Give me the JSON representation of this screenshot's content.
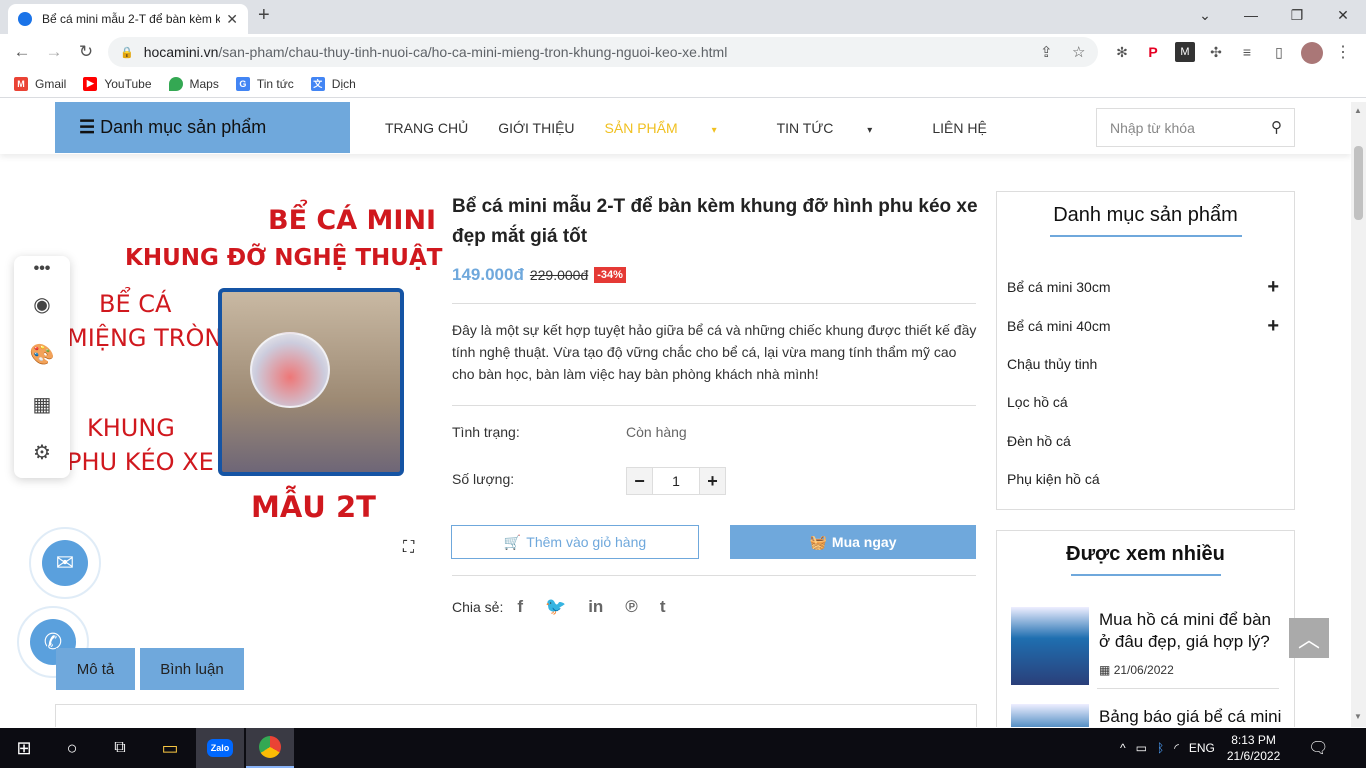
{
  "browser": {
    "tab_title": "Bể cá mini mẫu 2-T để bàn kèm k",
    "url_domain": "hocamini.vn",
    "url_path": "/san-pham/chau-thuy-tinh-nuoi-ca/ho-ca-mini-mieng-tron-khung-nguoi-keo-xe.html",
    "bookmarks": [
      {
        "label": "Gmail",
        "color": "#ea4335",
        "icon": "gmail-icon"
      },
      {
        "label": "YouTube",
        "color": "#ff0000",
        "icon": "youtube-icon"
      },
      {
        "label": "Maps",
        "color": "#34a853",
        "icon": "maps-icon"
      },
      {
        "label": "Tin tức",
        "color": "#4285f4",
        "icon": "news-icon"
      },
      {
        "label": "Dịch",
        "color": "#4285f4",
        "icon": "translate-icon"
      }
    ]
  },
  "site": {
    "category_button": "Danh mục sản phẩm",
    "menu": [
      "TRANG CHỦ",
      "GIỚI THIỆU",
      "SẢN PHẨM",
      "TIN TỨC",
      "LIÊN HỆ"
    ],
    "search_placeholder": "Nhập từ khóa",
    "accent": "#6fa8dc"
  },
  "product_image": {
    "line1": "BỂ CÁ MINI",
    "line2": "KHUNG ĐỠ NGHỆ THUẬT",
    "label1a": "BỂ CÁ",
    "label1b": "MIỆNG TRÒN",
    "label2a": "KHUNG",
    "label2b": "PHU KÉO XE",
    "model": "MẪU 2T"
  },
  "product": {
    "title": "Bể cá mini mẫu 2-T để bàn kèm khung đỡ hình phu kéo xe đẹp mắt giá tốt",
    "price_new": "149.000đ",
    "price_old": "229.000đ",
    "discount": "-34%",
    "description": "Đây là một sự kết hợp tuyệt hảo giữa bể cá và những chiếc khung được thiết kế đầy tính nghệ thuật. Vừa tạo độ vững chắc cho bể cá, lại vừa mang tính thẩm mỹ cao cho bàn học, bàn làm việc hay bàn phòng khách nhà mình!",
    "status_label": "Tình trạng:",
    "status_value": "Còn hàng",
    "qty_label": "Số lượng:",
    "qty_value": "1",
    "add_to_cart": "Thêm vào giỏ hàng",
    "buy_now": "Mua ngay",
    "share_label": "Chia sẻ:"
  },
  "tabs": [
    "Mô tả",
    "Bình luận"
  ],
  "sidebar": {
    "categories_title": "Danh mục sản phẩm",
    "categories": [
      "Bể cá mini 30cm",
      "Bể cá mini 40cm",
      "Chậu thủy tinh",
      "Lọc hồ cá",
      "Đèn hồ cá",
      "Phụ kiện hồ cá"
    ],
    "popular_title": "Được xem nhiều",
    "popular": [
      {
        "title": "Mua hồ cá mini để bàn ở đâu đẹp, giá hợp lý?",
        "date": "21/06/2022"
      },
      {
        "title": "Bảng báo giá bể cá mini",
        "date": ""
      }
    ]
  },
  "taskbar": {
    "lang": "ENG",
    "time": "8:13 PM",
    "date": "21/6/2022"
  }
}
